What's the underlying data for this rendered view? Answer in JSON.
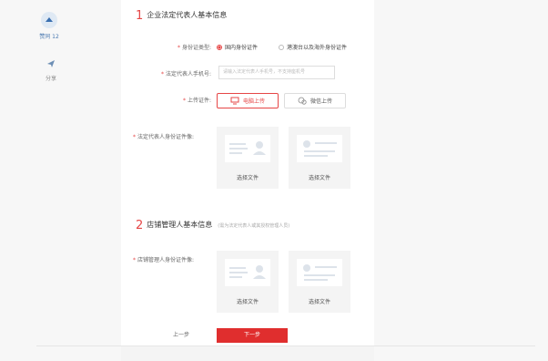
{
  "side": {
    "like_text": "赞同 12",
    "share_text": "分享"
  },
  "section1": {
    "number": "1",
    "title": "企业法定代表人基本信息"
  },
  "fields": {
    "id_type_label": "身份证类型:",
    "id_type_options": [
      "国内身份证件",
      "港澳台以及海外身份证件"
    ],
    "phone_label": "法定代表人手机号:",
    "phone_placeholder": "请输入法定代表人手机号，不支持座机号",
    "upload_label": "上传证件:",
    "upload_pc": "电脑上传",
    "upload_mobile": "微信上传",
    "id_photo_label": "法定代表人身份证件像:"
  },
  "cards": {
    "choose_file": "选择文件"
  },
  "section2": {
    "number": "2",
    "title": "店铺管理人基本信息",
    "subtitle": "(需为法定代表人或其授权管理人员)"
  },
  "manager": {
    "id_photo_label": "店铺管理人身份证件像:"
  },
  "footer": {
    "prev": "上一步",
    "next": "下一步"
  },
  "colors": {
    "accent": "#e64646",
    "primary_button": "#e02e2e",
    "link_blue": "#4a79b0"
  }
}
